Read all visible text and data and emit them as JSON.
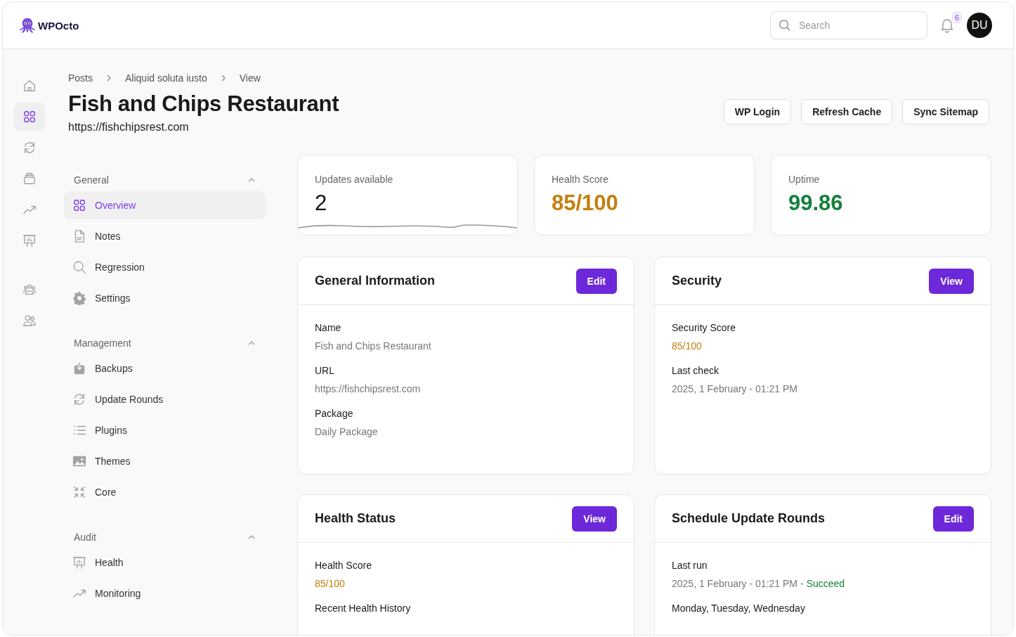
{
  "header": {
    "logo": "WPOcto",
    "search": {
      "placeholder": "Search"
    },
    "notifications": {
      "count": "6"
    },
    "avatar": {
      "initials": "DU"
    }
  },
  "rail": [
    {
      "selected": false
    },
    {
      "selected": true
    },
    {
      "selected": false
    },
    {
      "selected": false
    },
    {
      "selected": false
    },
    {
      "selected": false
    },
    {
      "selected": false
    },
    {
      "selected": false
    }
  ],
  "breadcrumb": [
    "Posts",
    "Aliquid soluta iusto",
    "View"
  ],
  "page": {
    "title": "Fish and Chips Restaurant",
    "url": "https://fishchipsrest.com"
  },
  "actions": [
    "WP Login",
    "Refresh Cache",
    "Sync Sitemap"
  ],
  "subnav": [
    {
      "title": "General",
      "expanded": true,
      "items": [
        {
          "label": "Overview",
          "selected": true
        },
        {
          "label": "Notes",
          "selected": false
        },
        {
          "label": "Regression",
          "selected": false
        },
        {
          "label": "Settings",
          "selected": false
        }
      ]
    },
    {
      "title": "Management",
      "expanded": true,
      "items": [
        {
          "label": "Backups",
          "selected": false
        },
        {
          "label": "Update Rounds",
          "selected": false
        },
        {
          "label": "Plugins",
          "selected": false
        },
        {
          "label": "Themes",
          "selected": false
        },
        {
          "label": "Core",
          "selected": false
        }
      ]
    },
    {
      "title": "Audit",
      "expanded": true,
      "items": [
        {
          "label": "Health",
          "selected": false
        },
        {
          "label": "Monitoring",
          "selected": false
        }
      ]
    }
  ],
  "stats": [
    {
      "label": "Updates available",
      "value": "2",
      "kind": "count",
      "sparkline": true
    },
    {
      "label": "Health Score",
      "value": "85/100",
      "kind": "warning",
      "sparkline": false
    },
    {
      "label": "Uptime",
      "value": "99.86",
      "kind": "success",
      "sparkline": false
    }
  ],
  "cards": [
    {
      "title": "General Information",
      "button": "Edit",
      "fields": [
        {
          "label": "Name",
          "value": "Fish and Chips Restaurant",
          "kind": "text"
        },
        {
          "label": "URL",
          "value": "https://fishchipsrest.com",
          "kind": "text"
        },
        {
          "label": "Package",
          "value": "Daily Package",
          "kind": "text"
        }
      ]
    },
    {
      "title": "Security",
      "button": "View",
      "fields": [
        {
          "label": "Security Score",
          "value": "85/100",
          "kind": "score"
        },
        {
          "label": "Last check",
          "value": "2025, 1 February - 01:21 PM",
          "kind": "text"
        }
      ]
    },
    {
      "title": "Health Status",
      "button": "View",
      "fields": [
        {
          "label": "Health Score",
          "value": "85/100",
          "kind": "score"
        },
        {
          "label": "Recent Health History"
        }
      ]
    },
    {
      "title": "Schedule Update Rounds",
      "button": "Edit",
      "fields": [
        {
          "label": "Last run",
          "value": "2025, 1 February - 01:21 PM",
          "kind": "text",
          "separator": "-",
          "status": {
            "text": "Succeed",
            "kind": "success"
          }
        },
        {
          "label": "Monday, Tuesday, Wednesday"
        }
      ]
    }
  ]
}
